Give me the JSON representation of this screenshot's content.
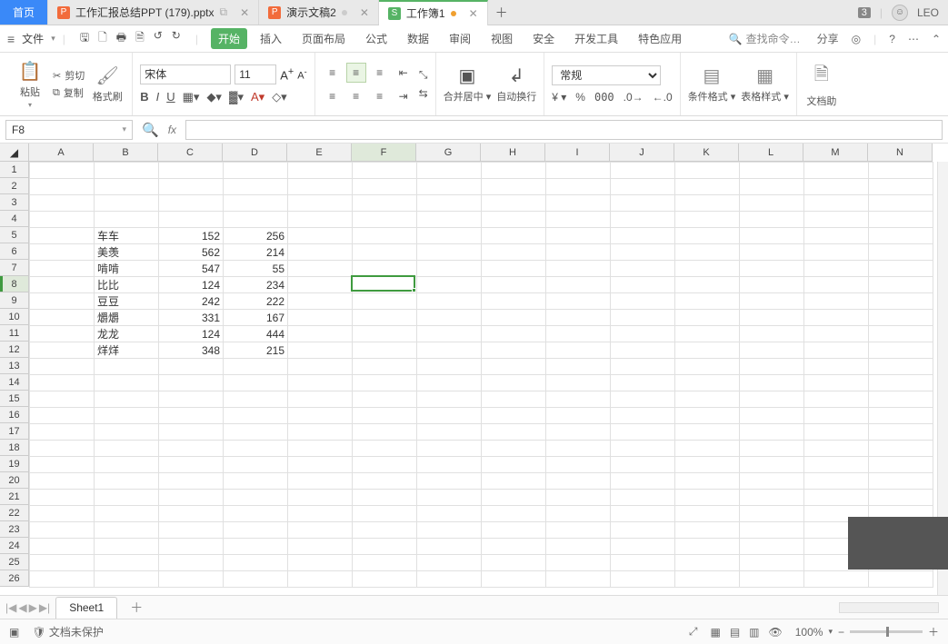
{
  "tabs": {
    "home": "首页",
    "t1": "工作汇报总结PPT (179).pptx",
    "t2": "演示文稿2",
    "t3": "工作簿1",
    "badge": "3",
    "user": "LEO"
  },
  "menubar": {
    "file": "文件",
    "rtabs": [
      "开始",
      "插入",
      "页面布局",
      "公式",
      "数据",
      "审阅",
      "视图",
      "安全",
      "开发工具",
      "特色应用"
    ],
    "search_ph": "查找命令…",
    "share": "分享"
  },
  "ribbon": {
    "paste": "粘贴",
    "cut": "剪切",
    "copy": "复制",
    "fmtpaint": "格式刷",
    "fontname": "宋体",
    "fontsize": "11",
    "mergecenter": "合并居中",
    "autowrap": "自动换行",
    "numfmt": "常规",
    "condfmt": "条件格式",
    "cellstyle": "表格样式",
    "dochelp": "文档助"
  },
  "namebox": "F8",
  "columns": [
    "A",
    "B",
    "C",
    "D",
    "E",
    "F",
    "G",
    "H",
    "I",
    "J",
    "K",
    "L",
    "M",
    "N"
  ],
  "rows_count": 26,
  "active_col_idx": 5,
  "active_row": 8,
  "cells": {
    "r5": {
      "B": "车车",
      "C": "152",
      "D": "256"
    },
    "r6": {
      "B": "美羡",
      "C": "562",
      "D": "214"
    },
    "r7": {
      "B": "啃啃",
      "C": "547",
      "D": "55"
    },
    "r8": {
      "B": "比比",
      "C": "124",
      "D": "234"
    },
    "r9": {
      "B": "豆豆",
      "C": "242",
      "D": "222"
    },
    "r10": {
      "B": "爝爝",
      "C": "331",
      "D": "167"
    },
    "r11": {
      "B": "龙龙",
      "C": "124",
      "D": "444"
    },
    "r12": {
      "B": "烊烊",
      "C": "348",
      "D": "215"
    }
  },
  "sheet": {
    "name": "Sheet1"
  },
  "status": {
    "protect": "文档未保护",
    "zoom": "100%"
  }
}
